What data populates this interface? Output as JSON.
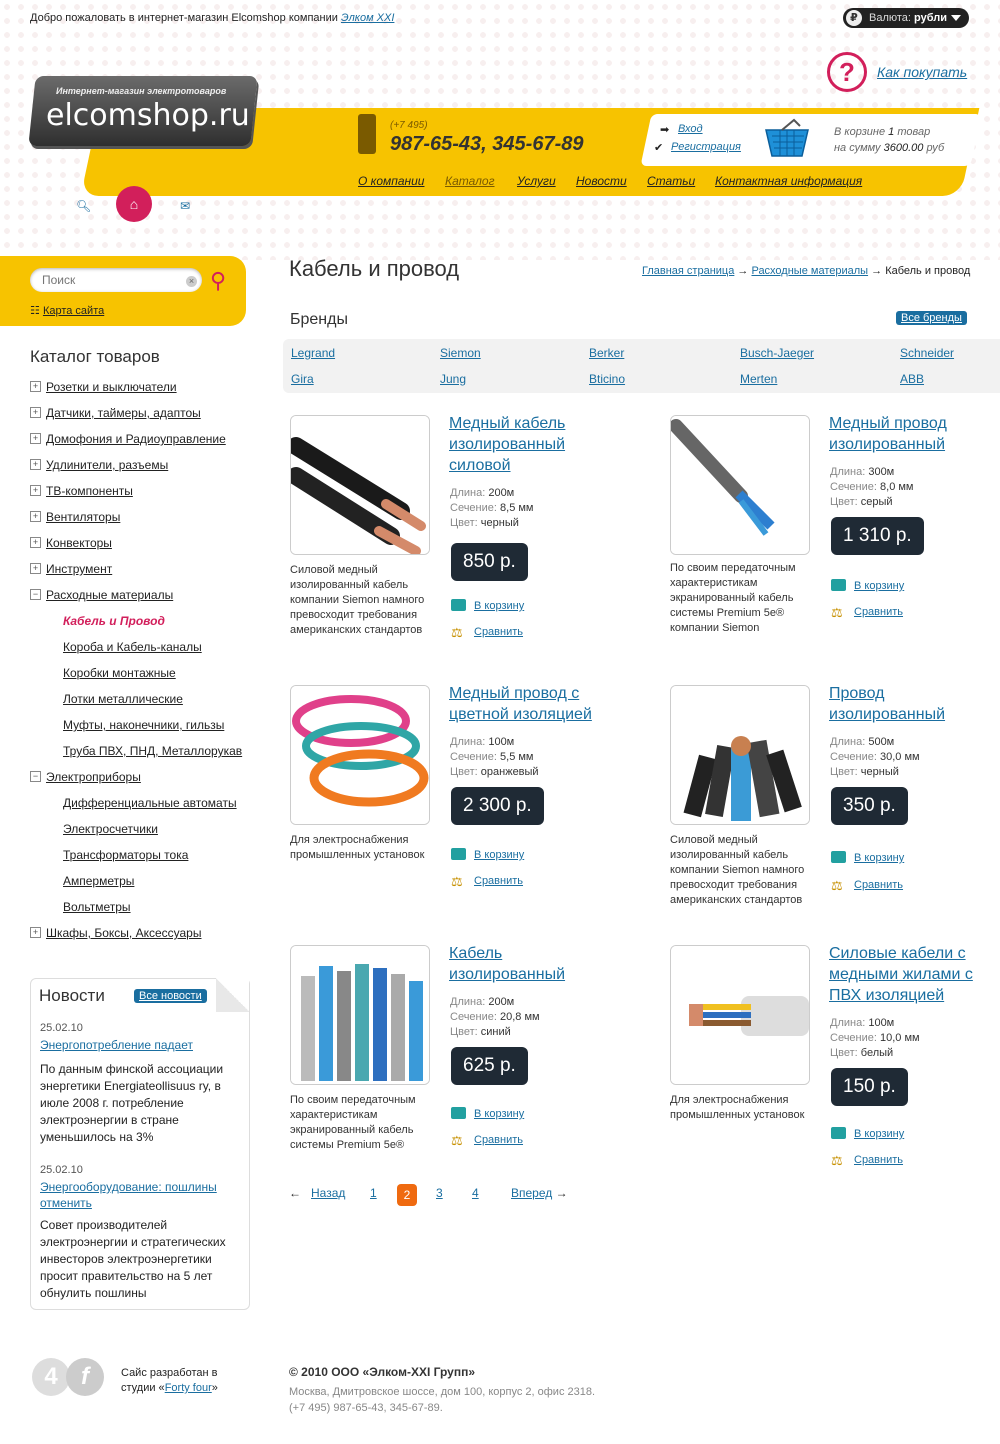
{
  "header": {
    "welcome_text": "Добро пожаловать в интернет-магазин Elcomshop компании ",
    "welcome_link": "Элком XXI",
    "currency_label": "Валюта:",
    "currency_value": "рубли",
    "currency_symbol": "₽",
    "how_to_buy": "Как покупать",
    "logo_subtitle": "Интернет-магазин электротоваров",
    "logo_title": "elcomshop.ru",
    "phone_code": "(+7 495)",
    "phone_numbers": "987-65-43, 345-67-89",
    "login": "Вход",
    "register": "Регистрация",
    "cart_line1_prefix": "В корзине ",
    "cart_count": "1",
    "cart_line1_suffix": " товар",
    "cart_line2_prefix": "на сумму ",
    "cart_sum": "3600.00",
    "cart_line2_suffix": " руб",
    "nav": [
      "О компании",
      "Каталог",
      "Услуги",
      "Новости",
      "Статьи",
      "Контактная информация"
    ]
  },
  "search": {
    "placeholder": "Поиск",
    "sitemap": "Карта сайта"
  },
  "catalog": {
    "title": "Каталог товаров",
    "items": [
      {
        "label": "Розетки и выключатели",
        "level": 0,
        "state": "+"
      },
      {
        "label": "Датчики, таймеры, адаптоы",
        "level": 0,
        "state": "+"
      },
      {
        "label": "Домофония и Радиоуправление",
        "level": 0,
        "state": "+"
      },
      {
        "label": "Удлинители, разъемы",
        "level": 0,
        "state": "+"
      },
      {
        "label": "ТВ-компоненты",
        "level": 0,
        "state": "+"
      },
      {
        "label": "Вентиляторы",
        "level": 0,
        "state": "+"
      },
      {
        "label": "Конвекторы",
        "level": 0,
        "state": "+"
      },
      {
        "label": "Инструмент",
        "level": 0,
        "state": "+"
      },
      {
        "label": "Расходные материалы",
        "level": 0,
        "state": "−"
      },
      {
        "label": "Кабель и Провод",
        "level": 1,
        "state": "current"
      },
      {
        "label": "Короба и Кабель-каналы",
        "level": 1,
        "state": ""
      },
      {
        "label": "Коробки монтажные",
        "level": 1,
        "state": ""
      },
      {
        "label": "Лотки металлические",
        "level": 1,
        "state": ""
      },
      {
        "label": "Муфты, наконечники, гильзы",
        "level": 1,
        "state": ""
      },
      {
        "label": "Труба ПВХ, ПНД, Металлорукав",
        "level": 1,
        "state": ""
      },
      {
        "label": "Электроприборы",
        "level": 0,
        "state": "−"
      },
      {
        "label": "Дифференциальные автоматы",
        "level": 1,
        "state": ""
      },
      {
        "label": "Электросчетчики",
        "level": 1,
        "state": ""
      },
      {
        "label": "Трансформаторы тока",
        "level": 1,
        "state": ""
      },
      {
        "label": "Амперметры",
        "level": 1,
        "state": ""
      },
      {
        "label": "Вольтметры",
        "level": 1,
        "state": ""
      },
      {
        "label": "Шкафы, Боксы, Аксессуары",
        "level": 0,
        "state": "+"
      }
    ]
  },
  "news": {
    "title": "Новости",
    "all": "Все новости",
    "items": [
      {
        "date": "25.02.10",
        "headline": "Энергопотребление падает",
        "text": "По данным финской ассоциации энергетики Energiateollisuus ry, в июле 2008 г. потребление электроэнергии в стране уменьшилось на 3%"
      },
      {
        "date": "25.02.10",
        "headline": "Энергооборудование: пошлины отменить",
        "text": "Совет производителей электроэнергии и стратегических инвесторов электроэнергетики просит правительство на 5 лет обнулить пошлины"
      }
    ]
  },
  "page": {
    "title": "Кабель и провод",
    "breadcrumbs": [
      "Главная страница",
      "Расходные материалы",
      "Кабель и провод"
    ],
    "breadcrumb_sep": " → "
  },
  "brands": {
    "title": "Бренды",
    "all": "Все бренды",
    "items": [
      "Legrand",
      "Siemon",
      "Berker",
      "Busch-Jaeger",
      "Schneider",
      "Gira",
      "Jung",
      "Bticino",
      "Merten",
      "ABB"
    ]
  },
  "labels": {
    "length": "Длина:",
    "section": "Сечение:",
    "color": "Цвет:",
    "to_cart": "В корзину",
    "compare": "Сравнить"
  },
  "products": [
    {
      "title": "Медный кабель изолированный силовой",
      "length": "200м",
      "section": "8,5 мм",
      "color": "черный",
      "price": "850 р.",
      "desc": "Силовой медный изолированный кабель компании Siemon намного превосходит требования американских стандартов"
    },
    {
      "title": "Медный провод изолированный",
      "length": "300м",
      "section": "8,0 мм",
      "color": "серый",
      "price": "1 310 р.",
      "desc": "По своим передаточным характеристикам экранированный кабель системы Premium 5e® компании Siemon"
    },
    {
      "title": "Медный провод с цветной изоляцией",
      "length": "100м",
      "section": "5,5 мм",
      "color": "оранжевый",
      "price": "2 300 р.",
      "desc": "Для электроснабжения промышленных установок"
    },
    {
      "title": "Провод изолированный",
      "length": "500м",
      "section": "30,0 мм",
      "color": "черный",
      "price": "350 р.",
      "desc": "Силовой медный изолированный кабель компании Siemon намного превосходит требования американских стандартов"
    },
    {
      "title": "Кабель изолированный",
      "length": "200м",
      "section": "20,8 мм",
      "color": "синий",
      "price": "625 р.",
      "desc": "По своим передаточным характеристикам экранированный кабель системы Premium 5e®"
    },
    {
      "title": "Силовые кабели с медными жилами с ПВХ изоляцией",
      "length": "100м",
      "section": "10,0 мм",
      "color": "белый",
      "price": "150 р.",
      "desc": "Для электроснабжения промышленных установок"
    }
  ],
  "pager": {
    "prev": "Назад",
    "next": "Вперед",
    "pages": [
      "1",
      "2",
      "3",
      "4"
    ],
    "current": "2"
  },
  "footer": {
    "dev_prefix": "Сайс разработан в студии «",
    "dev_link": "Forty four",
    "dev_suffix": "»",
    "logo_a": "4",
    "logo_b": "f",
    "copyright": "© 2010 ООО «Элком-XXI Групп»",
    "address": "Москва, Дмитровское шоссе, дом 100, корпус 2, офис 2318.",
    "phones": "(+7 495) 987-65-43, 345-67-89."
  }
}
